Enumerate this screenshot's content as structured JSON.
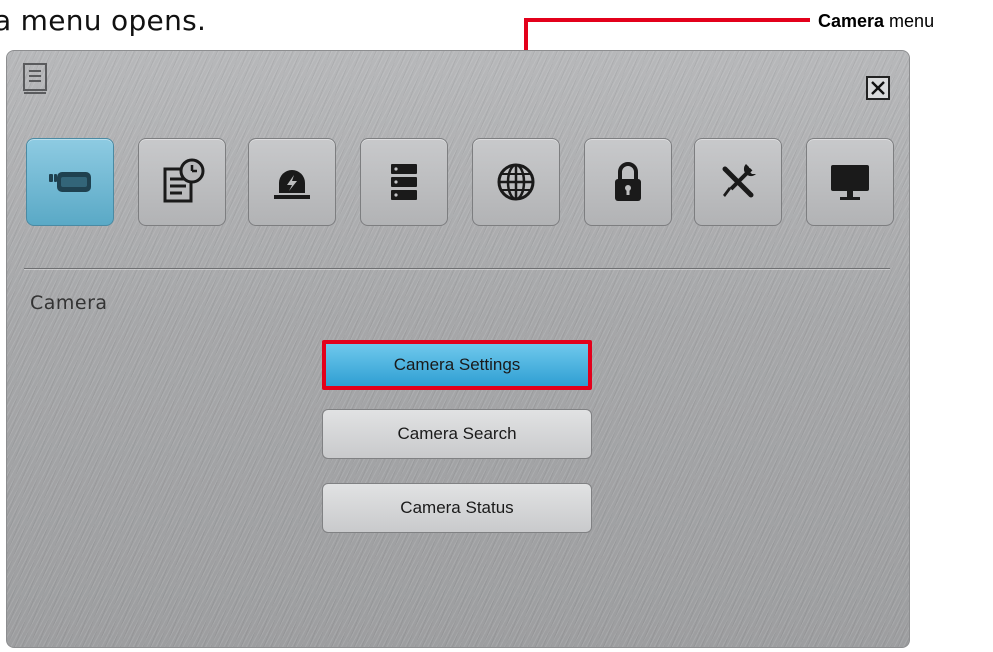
{
  "doc": {
    "intro_text": "a menu opens.",
    "callout_bold": "Camera",
    "callout_rest": " menu"
  },
  "dialog": {
    "section_title": "Camera",
    "tabs": [
      {
        "icon": "camera-icon",
        "active": true
      },
      {
        "icon": "schedule-icon",
        "active": false
      },
      {
        "icon": "alarm-icon",
        "active": false
      },
      {
        "icon": "storage-icon",
        "active": false
      },
      {
        "icon": "network-icon",
        "active": false
      },
      {
        "icon": "lock-icon",
        "active": false
      },
      {
        "icon": "tools-icon",
        "active": false
      },
      {
        "icon": "display-icon",
        "active": false
      }
    ],
    "buttons": [
      {
        "label": "Camera Settings",
        "selected": true
      },
      {
        "label": "Camera Search",
        "selected": false
      },
      {
        "label": "Camera Status",
        "selected": false
      }
    ]
  },
  "colors": {
    "highlight": "#e3001b",
    "active_tab": "#5aa9c6",
    "selected_button": "#2f9fd3"
  }
}
